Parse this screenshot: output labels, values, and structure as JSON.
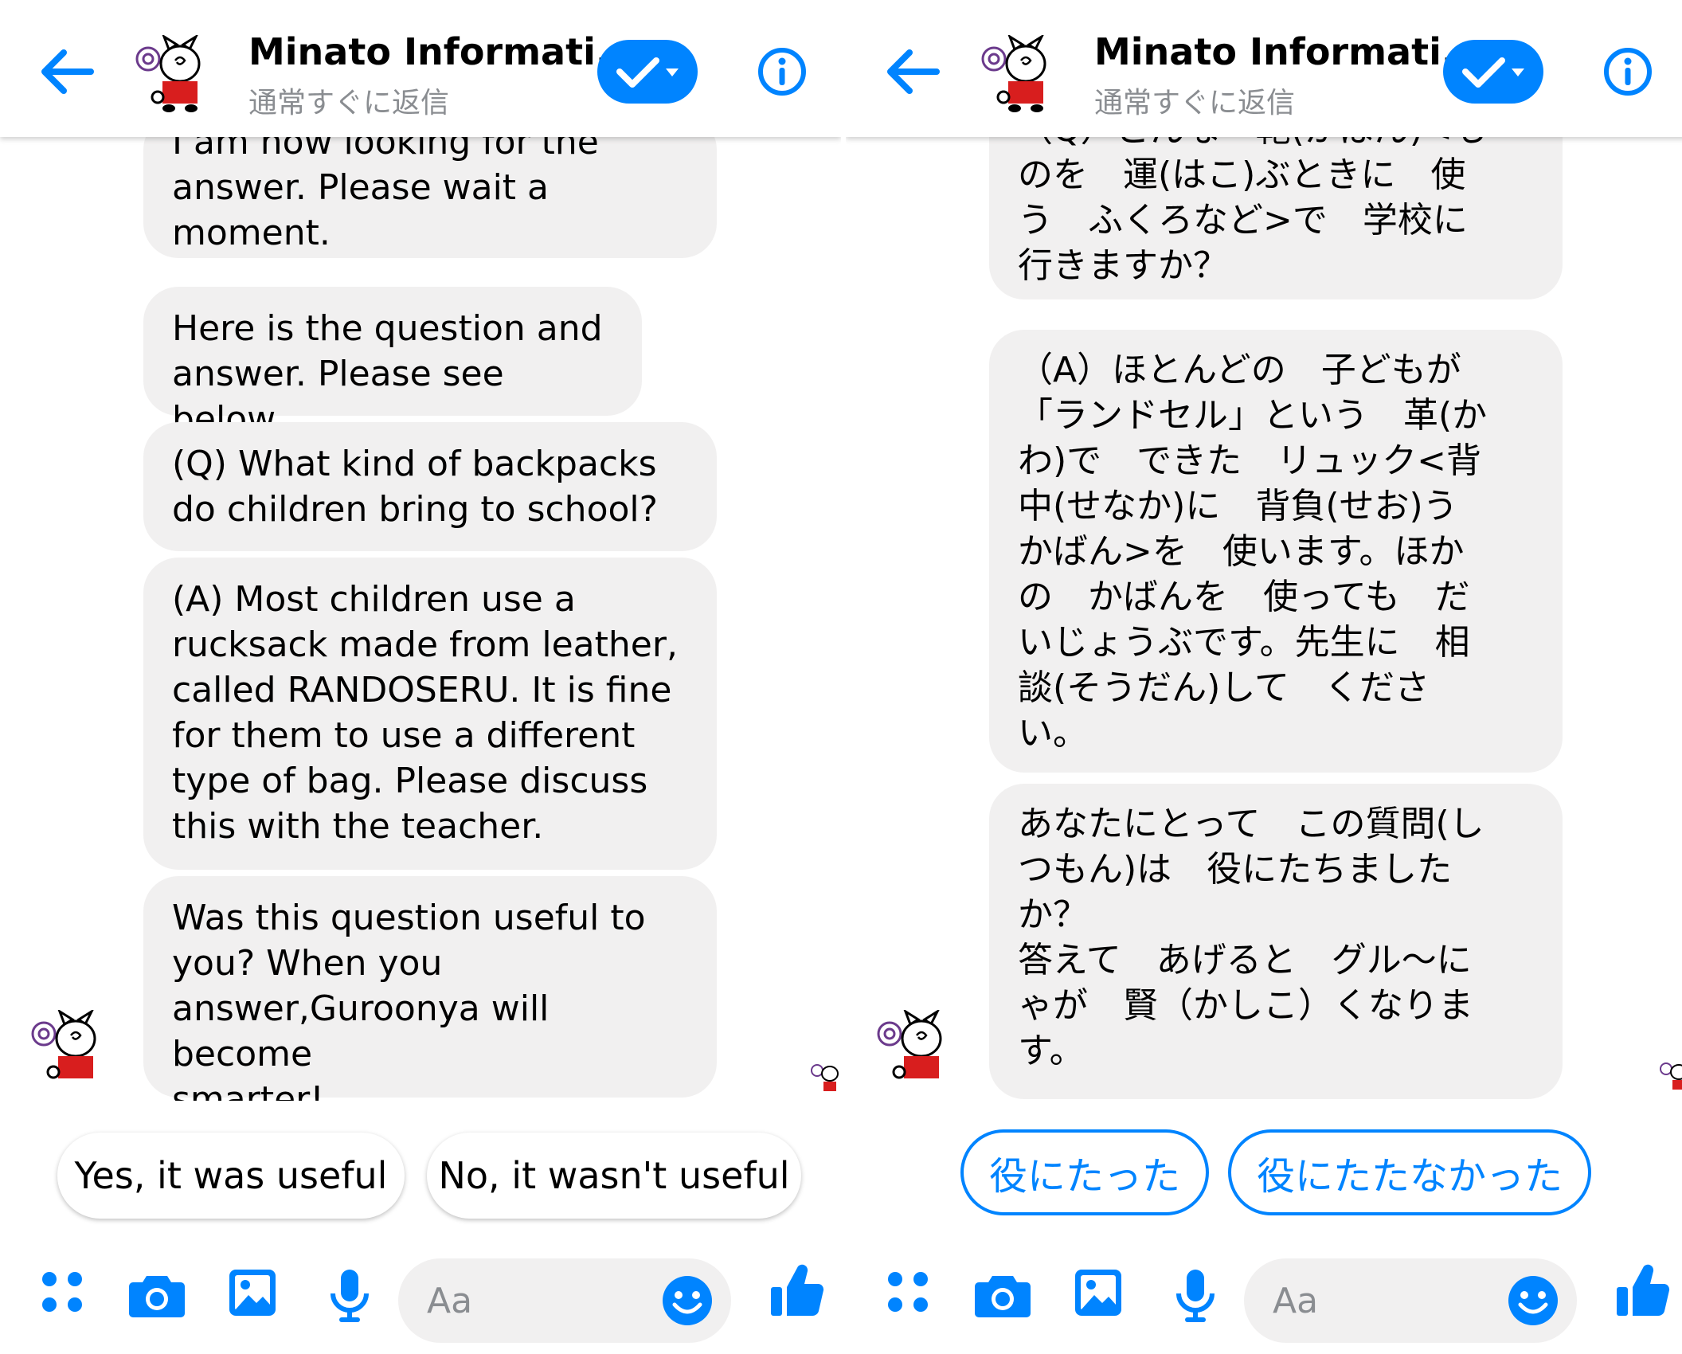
{
  "left": {
    "header": {
      "title": "Minato Informati...",
      "subtitle": "通常すぐに返信"
    },
    "messages": [
      "I am now looking for the\nanswer. Please wait a\nmoment.",
      "Here is the question and\nanswer. Please see below.",
      "(Q) What kind of backpacks\ndo children bring to school?",
      "(A) Most children use a\nrucksack made from leather,\ncalled RANDOSERU. It is fine\nfor them to use a different\ntype of bag. Please discuss\nthis with the teacher.",
      "Was this question useful to\nyou? When you\nanswer,Guroonya will become\nsmarter!"
    ],
    "quick_replies": [
      "Yes, it was useful",
      "No, it wasn't useful"
    ],
    "composer": {
      "placeholder": "Aa"
    }
  },
  "right": {
    "header": {
      "title": "Minato Informati...",
      "subtitle": "通常すぐに返信"
    },
    "messages": [
      "（Q）どんな　鞄(かばん)<も\nのを　運(はこ)ぶときに　使\nう　ふくろなど>で　学校に\n行きますか？",
      "（A）ほとんどの　子どもが\n「ランドセル」という　革(か\nわ)で　できた　リュック<背\n中(せなか)に　背負(せお)う\nかばん>を　使います。ほか\nの　かばんを　使っても　だ\nいじょうぶです。先生に　相\n談(そうだん)して　くださ\nい。",
      "あなたにとって　この質問(し\nつもん)は　役にたちました\nか？\n答えて　あげると　グル～に\nゃが　賢（かしこ）くなりま\nす。"
    ],
    "quick_replies": [
      "役にたった",
      "役にたたなかった"
    ],
    "composer": {
      "placeholder": "Aa"
    }
  },
  "colors": {
    "accent": "#0084ff",
    "bubble": "#f1f0f0",
    "secondary_text": "#8a8d91",
    "mascot_red": "#d81e1e"
  },
  "icons": [
    "back-arrow-icon",
    "check-dropdown-icon",
    "info-icon",
    "apps-icon",
    "camera-icon",
    "gallery-icon",
    "microphone-icon",
    "emoji-icon",
    "thumbs-up-icon"
  ]
}
